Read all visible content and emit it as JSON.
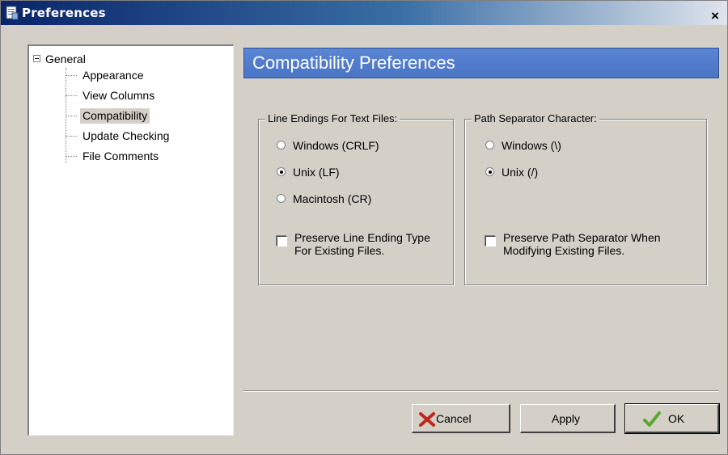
{
  "window": {
    "title": "Preferences",
    "close_label": "×"
  },
  "tree": {
    "root": {
      "label": "General",
      "expanded": true
    },
    "children": [
      {
        "label": "Appearance",
        "selected": false
      },
      {
        "label": "View Columns",
        "selected": false
      },
      {
        "label": "Compatibility",
        "selected": true
      },
      {
        "label": "Update Checking",
        "selected": false
      },
      {
        "label": "File Comments",
        "selected": false
      }
    ]
  },
  "panel": {
    "title": "Compatibility Preferences"
  },
  "line_endings": {
    "legend": "Line Endings For Text Files:",
    "options": [
      {
        "label": "Windows (CRLF)",
        "checked": false
      },
      {
        "label": "Unix (LF)",
        "checked": true
      },
      {
        "label": "Macintosh (CR)",
        "checked": false
      }
    ],
    "preserve_label": "Preserve Line Ending Type For Existing Files.",
    "preserve_checked": false
  },
  "path_separator": {
    "legend": "Path Separator Character:",
    "options": [
      {
        "label": "Windows (\\)",
        "checked": false
      },
      {
        "label": "Unix (/)",
        "checked": true
      }
    ],
    "preserve_label": "Preserve Path Separator When Modifying Existing Files.",
    "preserve_checked": false
  },
  "buttons": {
    "cancel": "Cancel",
    "apply": "Apply",
    "ok": "OK"
  },
  "icons": {
    "title": "preferences-icon",
    "cancel": "red-x-icon",
    "ok": "green-checkmark-icon"
  },
  "colors": {
    "header_bar": "#5b86d4",
    "titlebar_start": "#0a246a",
    "cancel_icon": "#c0281c",
    "ok_icon": "#5aa832"
  }
}
